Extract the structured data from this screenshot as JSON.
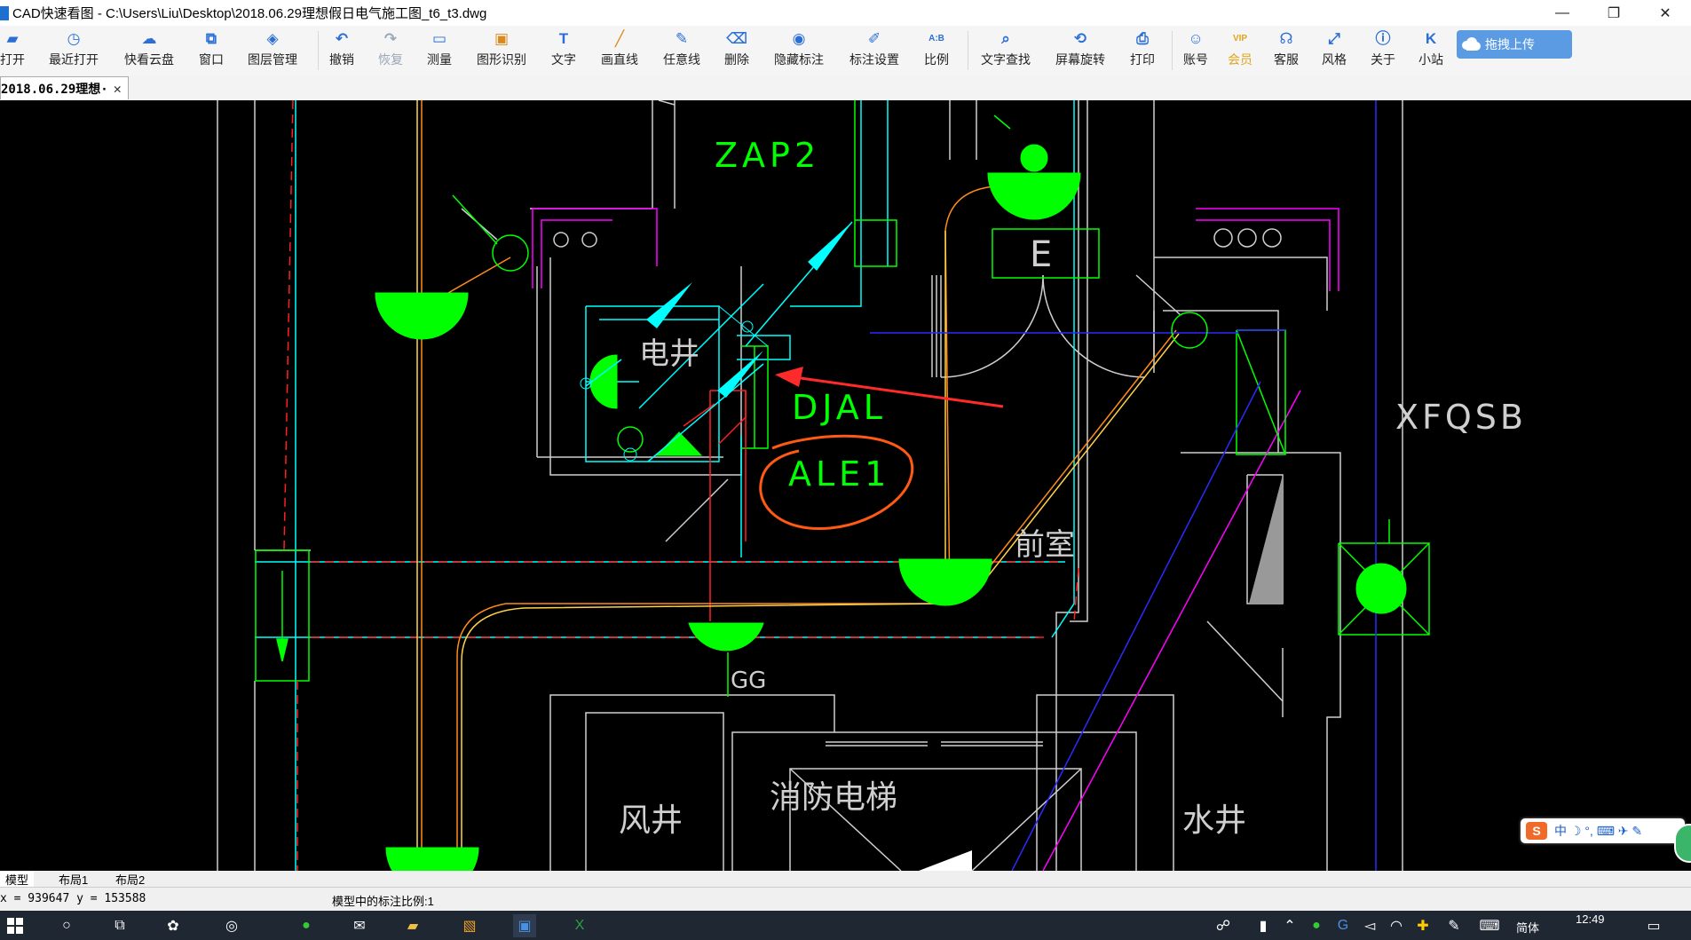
{
  "window": {
    "title": "CAD快速看图 - C:\\Users\\Liu\\Desktop\\2018.06.29理想假日电气施工图_t6_t3.dwg",
    "controls": {
      "minimize": "—",
      "restore": "❐",
      "close": "✕"
    }
  },
  "toolbar": {
    "items": [
      {
        "label": "打开",
        "icon": "folder-icon",
        "glyph": "▰",
        "color": "#2b6fd6"
      },
      {
        "label": "最近打开",
        "icon": "clock-icon",
        "glyph": "◷",
        "color": "#2b6fd6"
      },
      {
        "label": "快看云盘",
        "icon": "cloud-icon",
        "glyph": "☁",
        "color": "#2b6fd6"
      },
      {
        "label": "窗口",
        "icon": "window-icon",
        "glyph": "⧉",
        "color": "#2b6fd6"
      },
      {
        "label": "图层管理",
        "icon": "layers-icon",
        "glyph": "◈",
        "color": "#2b6fd6"
      },
      {
        "label": "撤销",
        "icon": "undo-icon",
        "glyph": "↶",
        "color": "#2b6fd6"
      },
      {
        "label": "恢复",
        "icon": "redo-icon",
        "glyph": "↷",
        "color": "#9aa7b8"
      },
      {
        "label": "测量",
        "icon": "ruler-icon",
        "glyph": "▭",
        "color": "#2b6fd6"
      },
      {
        "label": "图形识别",
        "icon": "shape-recognize-icon",
        "glyph": "▣",
        "color": "#d98a1c"
      },
      {
        "label": "文字",
        "icon": "text-icon",
        "glyph": "T",
        "color": "#2b6fd6"
      },
      {
        "label": "画直线",
        "icon": "line-icon",
        "glyph": "╱",
        "color": "#d98a1c"
      },
      {
        "label": "任意线",
        "icon": "pen-icon",
        "glyph": "✎",
        "color": "#2b6fd6"
      },
      {
        "label": "删除",
        "icon": "eraser-icon",
        "glyph": "⌫",
        "color": "#2b6fd6"
      },
      {
        "label": "隐藏标注",
        "icon": "eye-hide-icon",
        "glyph": "◉",
        "color": "#2b6fd6"
      },
      {
        "label": "标注设置",
        "icon": "annotation-settings-icon",
        "glyph": "✐",
        "color": "#2b6fd6"
      },
      {
        "label": "比例",
        "icon": "scale-icon",
        "glyph": "A:B",
        "color": "#2b6fd6"
      },
      {
        "label": "文字查找",
        "icon": "text-search-icon",
        "glyph": "⌕",
        "color": "#2b6fd6"
      },
      {
        "label": "屏幕旋转",
        "icon": "rotate-icon",
        "glyph": "⟲",
        "color": "#2b6fd6"
      },
      {
        "label": "打印",
        "icon": "printer-icon",
        "glyph": "⎙",
        "color": "#2b6fd6"
      },
      {
        "label": "账号",
        "icon": "user-icon",
        "glyph": "☺",
        "color": "#2b6fd6"
      },
      {
        "label": "会员",
        "icon": "vip-icon",
        "glyph": "VIP",
        "color": "#e2a51c"
      },
      {
        "label": "客服",
        "icon": "headset-icon",
        "glyph": "☊",
        "color": "#2b6fd6"
      },
      {
        "label": "风格",
        "icon": "style-icon",
        "glyph": "⤢",
        "color": "#2b6fd6"
      },
      {
        "label": "关于",
        "icon": "info-icon",
        "glyph": "ⓘ",
        "color": "#2b6fd6"
      },
      {
        "label": "小站",
        "icon": "k-site-icon",
        "glyph": "K",
        "color": "#2b6fd6"
      }
    ],
    "upload_label": "拖拽上传"
  },
  "tabs": {
    "document": "2018.06.29理想·",
    "close_glyph": "✕"
  },
  "drawing": {
    "labels": {
      "zap2": "ZAP2",
      "e": "E",
      "dianjing": "电井",
      "djal": "DJAL",
      "ale1": "ALE1",
      "xfqsb": "XFQSB",
      "qianshi": "前室",
      "gg": "GG",
      "fengjing": "风井",
      "xiaofangdianti": "消防电梯",
      "shuijing": "水井"
    },
    "colors": {
      "wall": "#cfcfcf",
      "green": "#00ff00",
      "cyan": "#00ffff",
      "magenta": "#ff00ff",
      "red": "#ff0000",
      "orange": "#ff8c00",
      "yellow": "#ffd24a",
      "blue": "#2b2bff",
      "annotation_red": "#ff2a2a",
      "annotation_orange": "#ff5a14"
    }
  },
  "layout_tabs": [
    "模型",
    "布局1",
    "布局2"
  ],
  "status": {
    "coordinates": "x = 939647 y = 153588",
    "scale_text": "模型中的标注比例:1"
  },
  "ime": {
    "logo": "S",
    "text": "中 ☽ °, ⌨ ✈ ✎"
  },
  "taskbar": {
    "time": "12:49",
    "lang": "简体"
  }
}
